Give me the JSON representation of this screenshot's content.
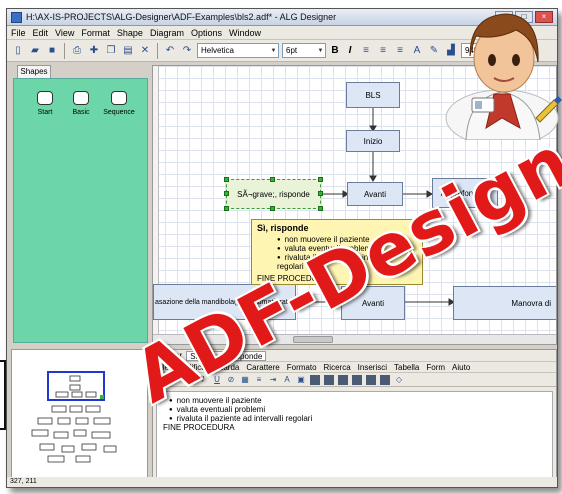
{
  "window": {
    "title": "H:\\AX-IS-PROJECTS\\ALG-Designer\\ADF-Examples\\bls2.adf* - ALG Designer",
    "menu": [
      "File",
      "Edit",
      "View",
      "Format",
      "Shape",
      "Diagram",
      "Options",
      "Window"
    ]
  },
  "toolbar": {
    "font": "Helvetica",
    "size": "6pt",
    "bold": "B",
    "italic": "I",
    "zoom": "94%"
  },
  "shapes_panel": {
    "tab": "Shapes",
    "items": [
      "Start",
      "Basic",
      "Sequence"
    ]
  },
  "diagram": {
    "nodes": {
      "bls": "BLS",
      "inizio": "Inizio",
      "avanti1": "Avanti",
      "sbigrave": "SÃ¬grave;, risponde",
      "approfondisci": "Approfondisci",
      "mandibola": "asazione della mandibola(paz.traumatizzato)",
      "avanti2": "Avanti",
      "manovra": "Manovra di"
    },
    "tooltip": {
      "title": "Sì, risponde",
      "items": [
        "non muovere il paziente",
        "valuta eventuali problemi",
        "rivaluta il paziente ad intervalli regolari"
      ],
      "footer": "FINE PROCEDURA"
    }
  },
  "editor": {
    "header_label": "Header",
    "header_value": "Sì&igrave;, risponde",
    "menu": [
      "File",
      "Modifica",
      "Guarda",
      "Carattere",
      "Formato",
      "Ricerca",
      "Inserisci",
      "Tabella",
      "Form",
      "Aiuto"
    ],
    "items": [
      "non muovere il paziente",
      "valuta eventuali problemi",
      "rivaluta il paziente ad intervalli regolari"
    ],
    "footer": "FINE PROCEDURA"
  },
  "status": {
    "coords": "327, 211"
  },
  "watermark": "ADF-Designer",
  "colors": {
    "shapes_bg": "#6cd6a8",
    "watermark": "#e21919",
    "tooltip_bg": "#fff5b3"
  }
}
